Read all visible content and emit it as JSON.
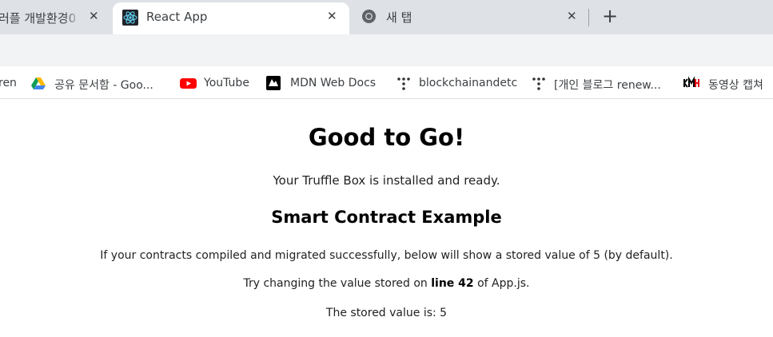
{
  "tabs": [
    {
      "title": "러플 개발환경0",
      "close": "✕"
    },
    {
      "title": "React App",
      "close": "✕"
    },
    {
      "title": "새 탭",
      "close": "✕"
    }
  ],
  "new_tab": "+",
  "bookmarks": [
    {
      "label": "ren"
    },
    {
      "label": "공유 문서함 - Goo..."
    },
    {
      "label": "YouTube"
    },
    {
      "label": "MDN Web Docs"
    },
    {
      "label": "blockchainandetc"
    },
    {
      "label": "[개인 블로그 renew..."
    },
    {
      "label": "동영상 캡쳐"
    }
  ],
  "content": {
    "heading": "Good to Go!",
    "intro": "Your Truffle Box is installed and ready.",
    "subheading": "Smart Contract Example",
    "description": "If your contracts compiled and migrated successfully, below will show a stored value of 5 (by default).",
    "try_prefix": "Try changing the value stored on ",
    "try_bold": "line 42",
    "try_suffix": " of App.js.",
    "stored_label": "The stored value is: 5"
  },
  "colors": {
    "tabstrip": "#dee1e6",
    "toolbar": "#f1f3f4",
    "react": "#61dafb",
    "youtube": "#ff0000"
  }
}
